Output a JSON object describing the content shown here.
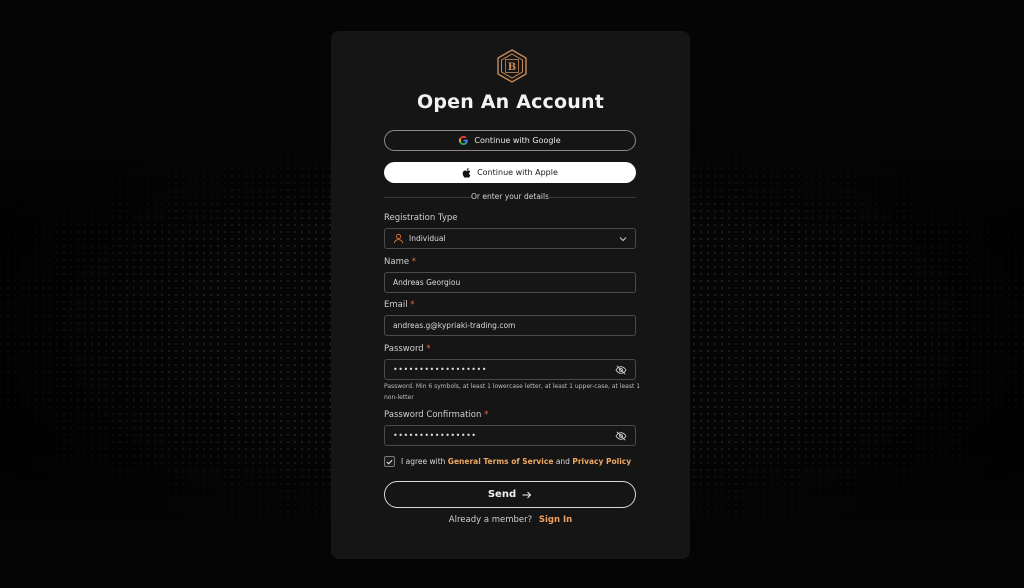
{
  "card": {
    "title": "Open An Account"
  },
  "oauth": {
    "google_label": "Continue with Google",
    "apple_label": "Continue with Apple"
  },
  "divider_text": "Or enter your details",
  "registration_type": {
    "label": "Registration Type",
    "value": "Individual",
    "icon": "user-icon"
  },
  "name": {
    "label": "Name",
    "required": "*",
    "value": "Andreas Georgiou"
  },
  "email": {
    "label": "Email",
    "required": "*",
    "value": "andreas.g@kypriaki-trading.com"
  },
  "password": {
    "label": "Password",
    "required": "*",
    "value": "••••••••••••••••••",
    "hint": "Password. Min 6 symbols, at least 1 lowercase letter, at least 1 upper-case, at least 1 non-letter"
  },
  "password_confirmation": {
    "label": "Password Confirmation",
    "required": "*",
    "value": "••••••••••••••••"
  },
  "agreement": {
    "checked": true,
    "prefix": "I agree with",
    "terms_link": "General Terms of Service",
    "and": "and",
    "privacy_link": "Privacy Policy"
  },
  "send_label": "Send",
  "footer": {
    "question": "Already a member?",
    "signin_label": "Sign In"
  },
  "colors": {
    "accent": "#f0a860",
    "required": "#e0703a",
    "card_bg": "#151515",
    "page_bg": "#050505"
  }
}
